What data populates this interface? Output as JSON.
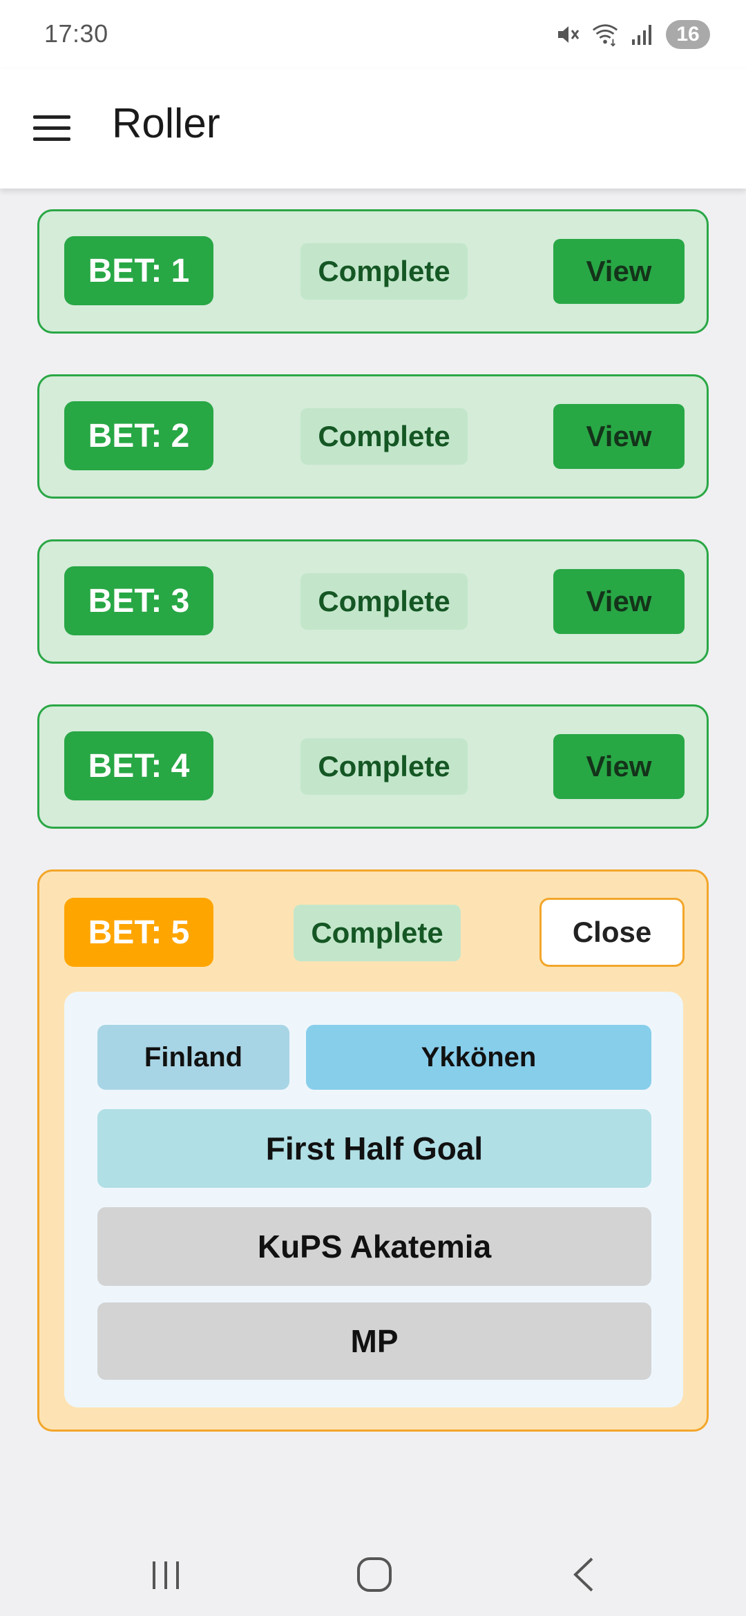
{
  "status_bar": {
    "time": "17:30",
    "notification_count": "16",
    "icons": [
      "mute-icon",
      "wifi-icon",
      "signal-icon"
    ]
  },
  "app_bar": {
    "title": "Roller",
    "menu_icon": "hamburger-menu-icon"
  },
  "bets": [
    {
      "label": "BET: 1",
      "status": "Complete",
      "action": "View"
    },
    {
      "label": "BET: 2",
      "status": "Complete",
      "action": "View"
    },
    {
      "label": "BET: 3",
      "status": "Complete",
      "action": "View"
    },
    {
      "label": "BET: 4",
      "status": "Complete",
      "action": "View"
    }
  ],
  "expanded_bet": {
    "label": "BET: 5",
    "status": "Complete",
    "action": "Close",
    "details": {
      "country": "Finland",
      "league": "Ykkönen",
      "market": "First Half Goal",
      "home_team": "KuPS Akatemia",
      "away_team": "MP"
    }
  },
  "nav_bar": {
    "icons": [
      "recent-apps-icon",
      "home-icon",
      "back-icon"
    ]
  },
  "colors": {
    "complete_green": "#28a745",
    "complete_card_bg": "#d4ecd8",
    "status_chip_bg": "#c3e6cb",
    "status_chip_text": "#155724",
    "open_orange": "#ffa500",
    "open_card_bg": "#fde3b3",
    "detail_panel_bg": "#eef6fc",
    "country_pill": "#a8d5e5",
    "league_pill": "#87ceeb",
    "market_pill": "#b0dfe5",
    "team_pill": "#d3d3d3"
  }
}
